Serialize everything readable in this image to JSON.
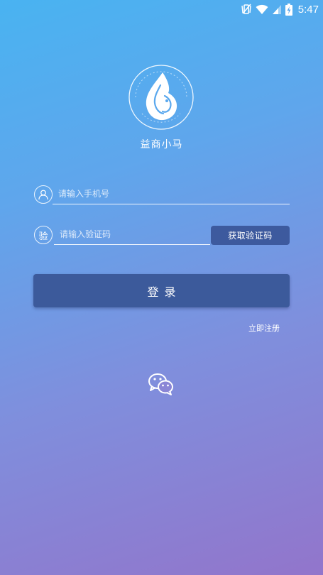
{
  "status_bar": {
    "time": "5:47",
    "icons": [
      "vibrate-off-icon",
      "wifi-icon",
      "signal-icon",
      "battery-charging-icon"
    ]
  },
  "app": {
    "name": "益商小马",
    "logo_icon": "horse-flame-logo"
  },
  "form": {
    "phone_placeholder": "请输入手机号",
    "phone_value": "",
    "phone_icon": "user-icon",
    "code_placeholder": "请输入验证码",
    "code_value": "",
    "code_icon_label": "验",
    "get_code_label": "获取验证码",
    "login_label": "登录",
    "register_label": "立即注册"
  },
  "social": {
    "wechat_icon": "wechat-icon"
  },
  "colors": {
    "gradient_start": "#49b3f1",
    "gradient_end": "#9275cb",
    "button": "#3c5a9b"
  }
}
